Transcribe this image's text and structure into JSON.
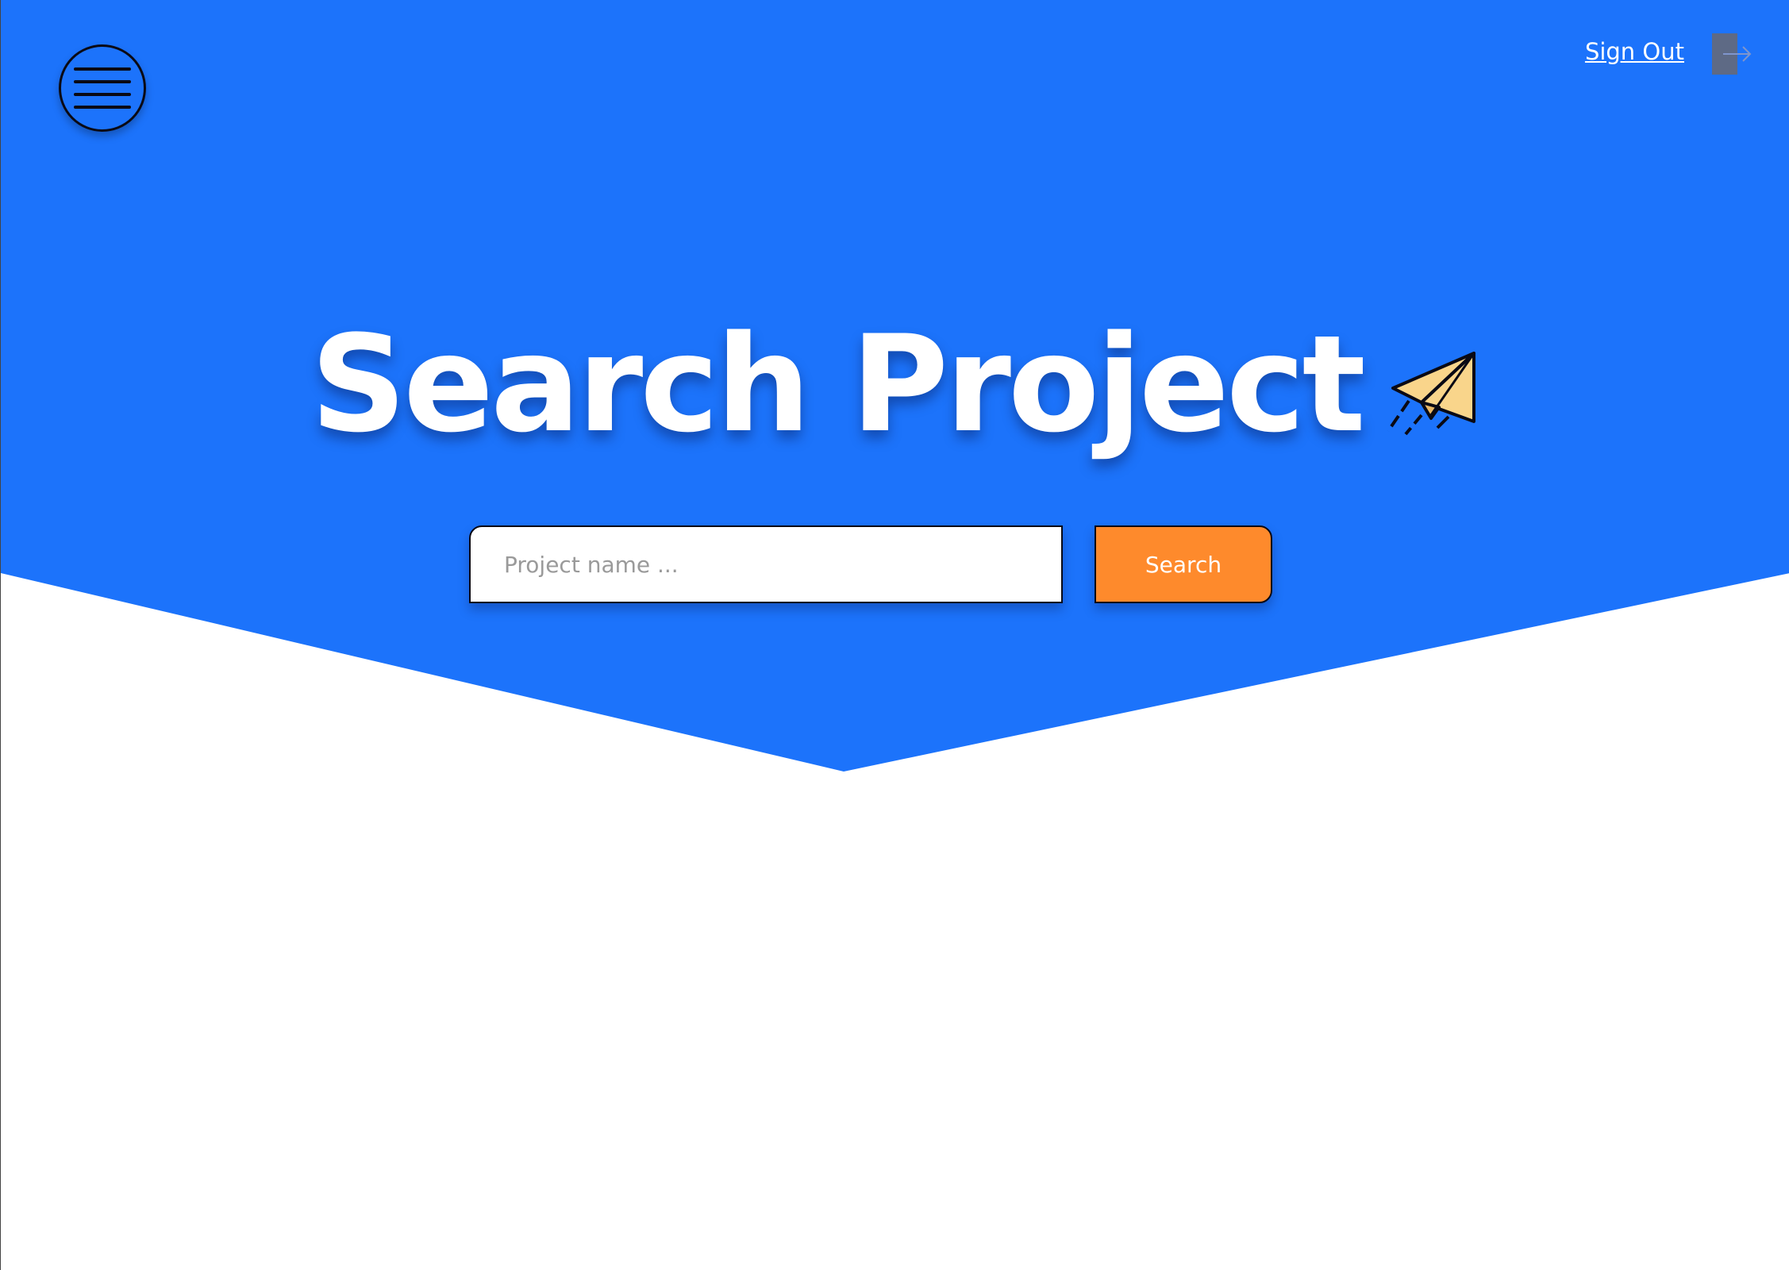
{
  "header": {
    "menu_icon": "hamburger-menu-icon",
    "signout_label": "Sign Out",
    "signout_icon": "sign-out-arrow-icon"
  },
  "hero": {
    "title": "Search Project",
    "title_icon": "paper-plane-icon",
    "search_placeholder": "Project name ...",
    "search_button_label": "Search"
  },
  "colors": {
    "hero_background": "#1c73fb",
    "search_button": "#fe8a2c",
    "page_background": "#ffffff",
    "plane_fill": "#f9d58b"
  }
}
